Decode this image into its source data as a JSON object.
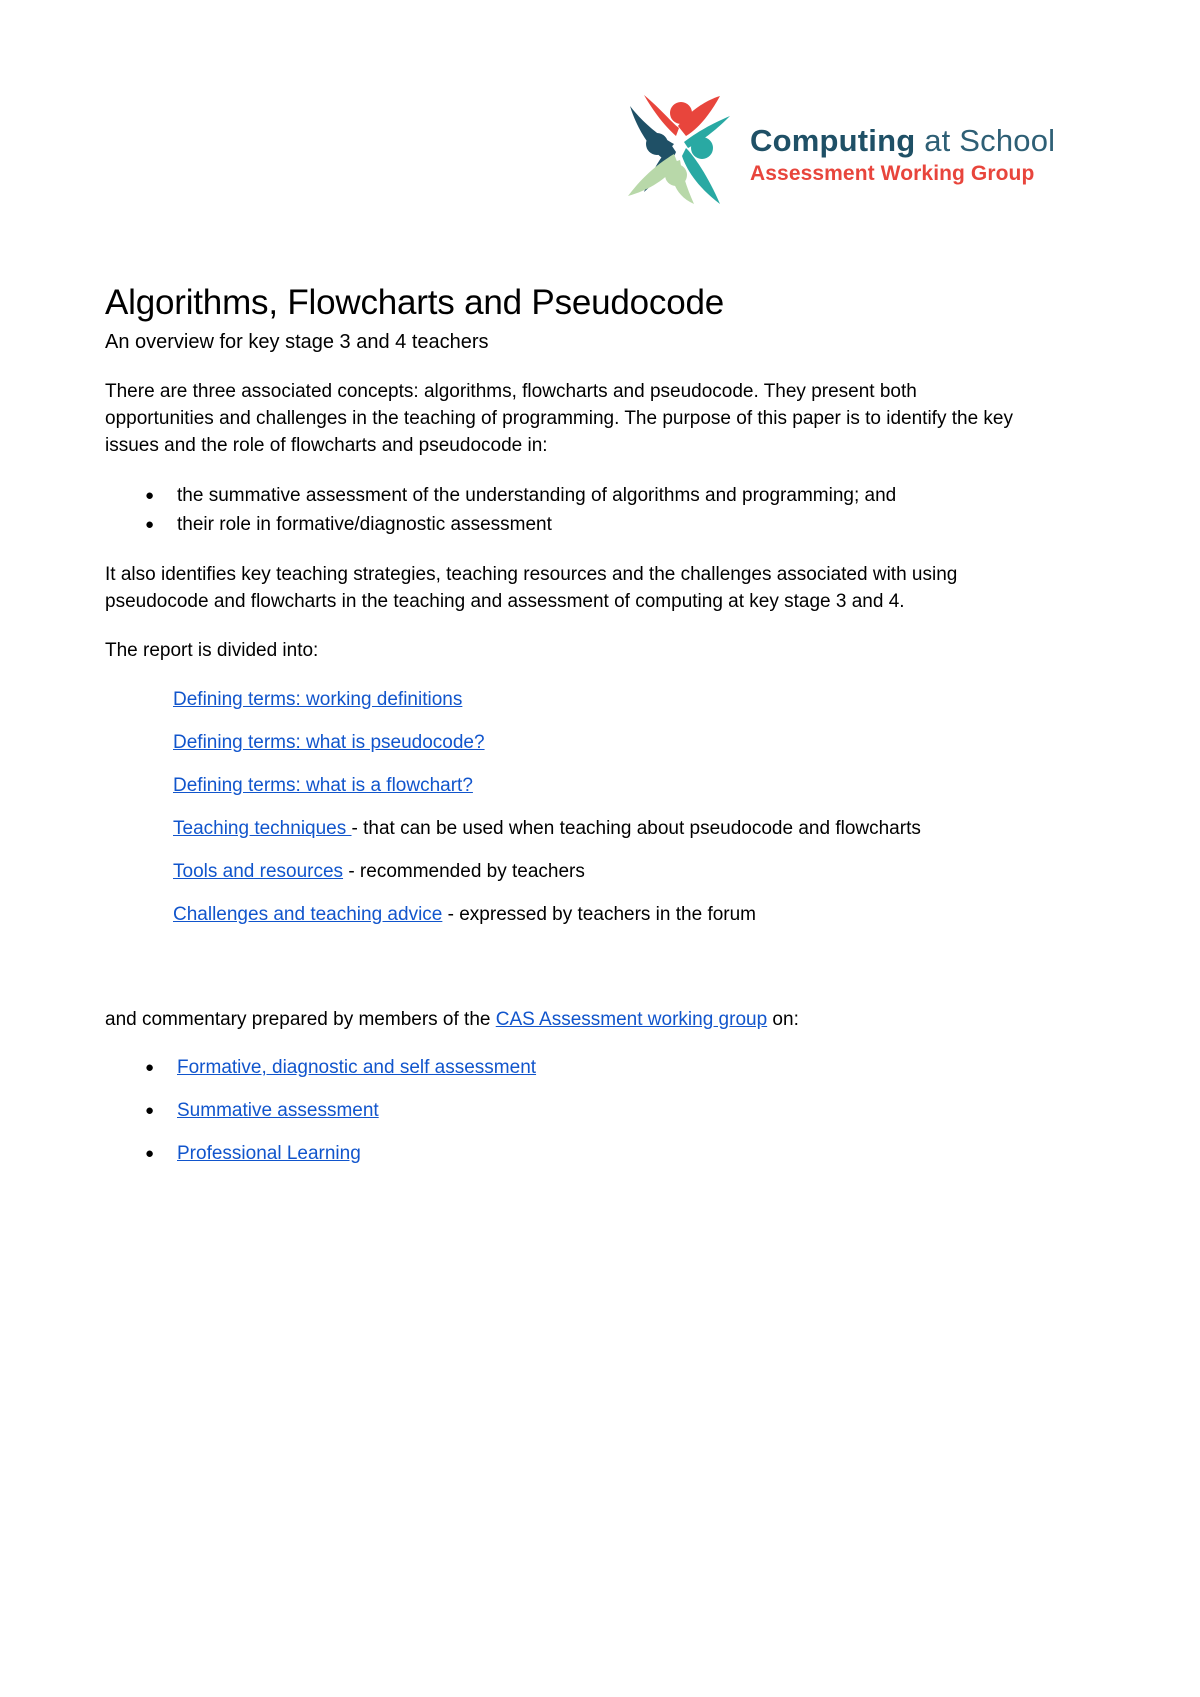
{
  "logo": {
    "brand_bold": "Computing",
    "brand_rest": " at School",
    "subtitle": "Assessment Working Group",
    "colors": {
      "red": "#e8453c",
      "navy": "#1f5066",
      "teal": "#29a9a3",
      "light_green": "#b8d8a9",
      "text_blue": "#2e5f75"
    }
  },
  "document": {
    "title": "Algorithms, Flowcharts and Pseudocode",
    "subtitle": "An overview for key stage 3 and 4 teachers",
    "intro_paragraph": "There are three associated concepts: algorithms, flowcharts and pseudocode. They present both opportunities and challenges in the teaching of programming. The purpose of this paper is to identify the key issues and the role of flowcharts and pseudocode in:",
    "intro_bullets": [
      "the summative assessment of the understanding of algorithms and programming; and",
      "their role in formative/diagnostic assessment"
    ],
    "second_paragraph": "It also identifies key teaching strategies, teaching resources and the challenges associated with using pseudocode and flowcharts in the teaching and assessment of computing at key stage 3 and 4.",
    "divided_intro": "The report is divided into:",
    "section_links": [
      {
        "link": "Defining terms: working definitions",
        "trailing": ""
      },
      {
        "link": "Defining terms: what is pseudocode?",
        "trailing": ""
      },
      {
        "link": "Defining terms: what is a flowchart?",
        "trailing": ""
      },
      {
        "link": "Teaching techniques ",
        "trailing": " - that can be used when teaching about pseudocode and flowcharts"
      },
      {
        "link": "Tools and resources",
        "trailing": " - recommended by teachers"
      },
      {
        "link": "Challenges and teaching advice",
        "trailing": " - expressed by teachers in the forum"
      }
    ],
    "commentary_prefix": "and commentary prepared by members of the ",
    "commentary_link": "CAS Assessment working group",
    "commentary_suffix": " on:",
    "commentary_bullets": [
      "Formative, diagnostic and self assessment",
      "Summative assessment",
      "Professional Learning"
    ],
    "bullet_glyph": "●",
    "link_color": "#1155cc"
  }
}
